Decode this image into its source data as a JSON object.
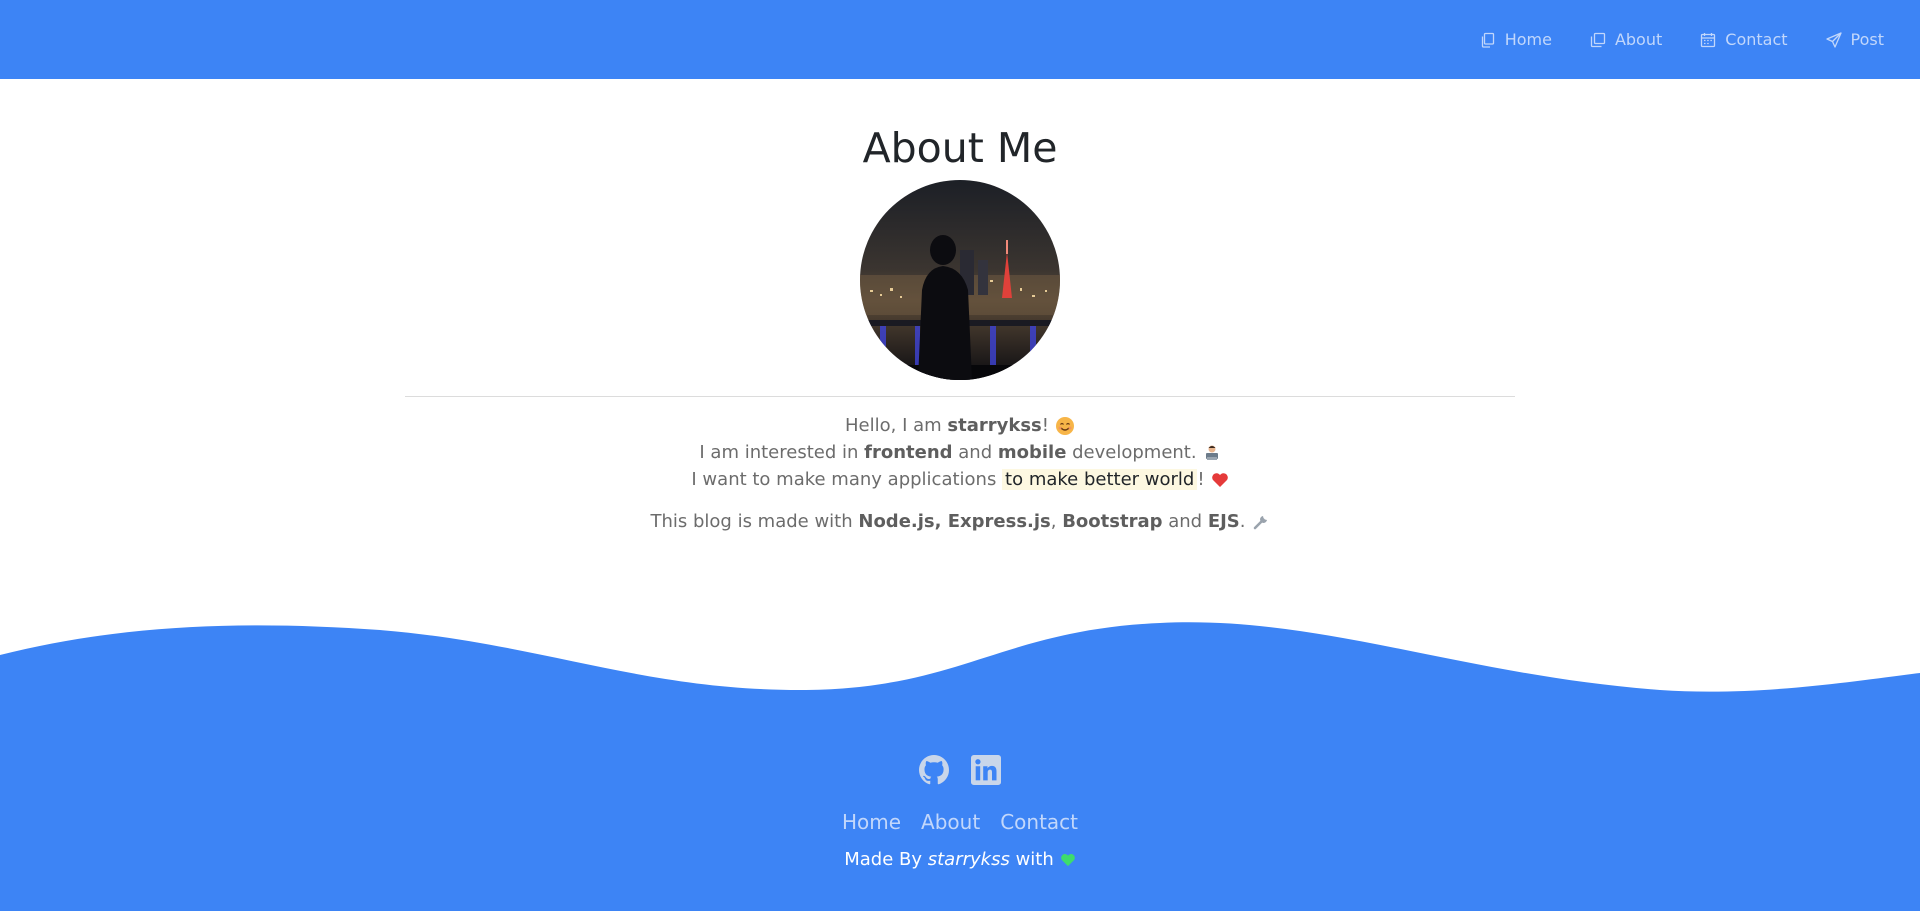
{
  "nav": {
    "items": [
      {
        "label": "Home",
        "icon": "files-icon"
      },
      {
        "label": "About",
        "icon": "copy-icon"
      },
      {
        "label": "Contact",
        "icon": "calendar-icon"
      },
      {
        "label": "Post",
        "icon": "send-icon"
      }
    ]
  },
  "main": {
    "title": "About Me",
    "bio": {
      "line1": {
        "pre": "Hello, I am ",
        "name": "starrykss",
        "post": "!"
      },
      "line2": {
        "pre": "I am interested in ",
        "b1": "frontend",
        "mid": " and ",
        "b2": "mobile",
        "post": " development."
      },
      "line3": {
        "pre": "I want to make many applications ",
        "highlight": "to make better world",
        "post": "!"
      },
      "line4": {
        "pre": "This blog is made with ",
        "b1": "Node.js, Express.js",
        "sep": ", ",
        "b2": "Bootstrap",
        "mid": " and ",
        "b3": "EJS",
        "post": "."
      }
    }
  },
  "footer": {
    "social": [
      {
        "icon": "github-icon"
      },
      {
        "icon": "linkedin-icon"
      }
    ],
    "links": [
      "Home",
      "About",
      "Contact"
    ],
    "credit": {
      "pre": "Made By ",
      "name": "starrykss",
      "post": " with"
    }
  },
  "colors": {
    "primary": "#3d84f5",
    "nav_text": "#c2d7fb",
    "highlight_bg": "#fdf8e1"
  }
}
